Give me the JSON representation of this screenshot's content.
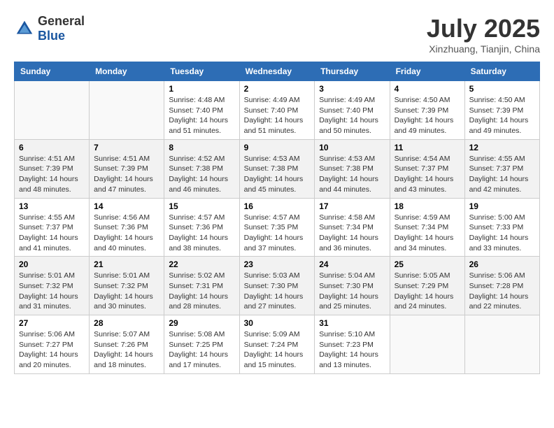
{
  "header": {
    "logo_general": "General",
    "logo_blue": "Blue",
    "month_title": "July 2025",
    "location": "Xinzhuang, Tianjin, China"
  },
  "days_of_week": [
    "Sunday",
    "Monday",
    "Tuesday",
    "Wednesday",
    "Thursday",
    "Friday",
    "Saturday"
  ],
  "weeks": [
    [
      {
        "day": "",
        "sunrise": "",
        "sunset": "",
        "daylight": ""
      },
      {
        "day": "",
        "sunrise": "",
        "sunset": "",
        "daylight": ""
      },
      {
        "day": "1",
        "sunrise": "Sunrise: 4:48 AM",
        "sunset": "Sunset: 7:40 PM",
        "daylight": "Daylight: 14 hours and 51 minutes."
      },
      {
        "day": "2",
        "sunrise": "Sunrise: 4:49 AM",
        "sunset": "Sunset: 7:40 PM",
        "daylight": "Daylight: 14 hours and 51 minutes."
      },
      {
        "day": "3",
        "sunrise": "Sunrise: 4:49 AM",
        "sunset": "Sunset: 7:40 PM",
        "daylight": "Daylight: 14 hours and 50 minutes."
      },
      {
        "day": "4",
        "sunrise": "Sunrise: 4:50 AM",
        "sunset": "Sunset: 7:39 PM",
        "daylight": "Daylight: 14 hours and 49 minutes."
      },
      {
        "day": "5",
        "sunrise": "Sunrise: 4:50 AM",
        "sunset": "Sunset: 7:39 PM",
        "daylight": "Daylight: 14 hours and 49 minutes."
      }
    ],
    [
      {
        "day": "6",
        "sunrise": "Sunrise: 4:51 AM",
        "sunset": "Sunset: 7:39 PM",
        "daylight": "Daylight: 14 hours and 48 minutes."
      },
      {
        "day": "7",
        "sunrise": "Sunrise: 4:51 AM",
        "sunset": "Sunset: 7:39 PM",
        "daylight": "Daylight: 14 hours and 47 minutes."
      },
      {
        "day": "8",
        "sunrise": "Sunrise: 4:52 AM",
        "sunset": "Sunset: 7:38 PM",
        "daylight": "Daylight: 14 hours and 46 minutes."
      },
      {
        "day": "9",
        "sunrise": "Sunrise: 4:53 AM",
        "sunset": "Sunset: 7:38 PM",
        "daylight": "Daylight: 14 hours and 45 minutes."
      },
      {
        "day": "10",
        "sunrise": "Sunrise: 4:53 AM",
        "sunset": "Sunset: 7:38 PM",
        "daylight": "Daylight: 14 hours and 44 minutes."
      },
      {
        "day": "11",
        "sunrise": "Sunrise: 4:54 AM",
        "sunset": "Sunset: 7:37 PM",
        "daylight": "Daylight: 14 hours and 43 minutes."
      },
      {
        "day": "12",
        "sunrise": "Sunrise: 4:55 AM",
        "sunset": "Sunset: 7:37 PM",
        "daylight": "Daylight: 14 hours and 42 minutes."
      }
    ],
    [
      {
        "day": "13",
        "sunrise": "Sunrise: 4:55 AM",
        "sunset": "Sunset: 7:37 PM",
        "daylight": "Daylight: 14 hours and 41 minutes."
      },
      {
        "day": "14",
        "sunrise": "Sunrise: 4:56 AM",
        "sunset": "Sunset: 7:36 PM",
        "daylight": "Daylight: 14 hours and 40 minutes."
      },
      {
        "day": "15",
        "sunrise": "Sunrise: 4:57 AM",
        "sunset": "Sunset: 7:36 PM",
        "daylight": "Daylight: 14 hours and 38 minutes."
      },
      {
        "day": "16",
        "sunrise": "Sunrise: 4:57 AM",
        "sunset": "Sunset: 7:35 PM",
        "daylight": "Daylight: 14 hours and 37 minutes."
      },
      {
        "day": "17",
        "sunrise": "Sunrise: 4:58 AM",
        "sunset": "Sunset: 7:34 PM",
        "daylight": "Daylight: 14 hours and 36 minutes."
      },
      {
        "day": "18",
        "sunrise": "Sunrise: 4:59 AM",
        "sunset": "Sunset: 7:34 PM",
        "daylight": "Daylight: 14 hours and 34 minutes."
      },
      {
        "day": "19",
        "sunrise": "Sunrise: 5:00 AM",
        "sunset": "Sunset: 7:33 PM",
        "daylight": "Daylight: 14 hours and 33 minutes."
      }
    ],
    [
      {
        "day": "20",
        "sunrise": "Sunrise: 5:01 AM",
        "sunset": "Sunset: 7:32 PM",
        "daylight": "Daylight: 14 hours and 31 minutes."
      },
      {
        "day": "21",
        "sunrise": "Sunrise: 5:01 AM",
        "sunset": "Sunset: 7:32 PM",
        "daylight": "Daylight: 14 hours and 30 minutes."
      },
      {
        "day": "22",
        "sunrise": "Sunrise: 5:02 AM",
        "sunset": "Sunset: 7:31 PM",
        "daylight": "Daylight: 14 hours and 28 minutes."
      },
      {
        "day": "23",
        "sunrise": "Sunrise: 5:03 AM",
        "sunset": "Sunset: 7:30 PM",
        "daylight": "Daylight: 14 hours and 27 minutes."
      },
      {
        "day": "24",
        "sunrise": "Sunrise: 5:04 AM",
        "sunset": "Sunset: 7:30 PM",
        "daylight": "Daylight: 14 hours and 25 minutes."
      },
      {
        "day": "25",
        "sunrise": "Sunrise: 5:05 AM",
        "sunset": "Sunset: 7:29 PM",
        "daylight": "Daylight: 14 hours and 24 minutes."
      },
      {
        "day": "26",
        "sunrise": "Sunrise: 5:06 AM",
        "sunset": "Sunset: 7:28 PM",
        "daylight": "Daylight: 14 hours and 22 minutes."
      }
    ],
    [
      {
        "day": "27",
        "sunrise": "Sunrise: 5:06 AM",
        "sunset": "Sunset: 7:27 PM",
        "daylight": "Daylight: 14 hours and 20 minutes."
      },
      {
        "day": "28",
        "sunrise": "Sunrise: 5:07 AM",
        "sunset": "Sunset: 7:26 PM",
        "daylight": "Daylight: 14 hours and 18 minutes."
      },
      {
        "day": "29",
        "sunrise": "Sunrise: 5:08 AM",
        "sunset": "Sunset: 7:25 PM",
        "daylight": "Daylight: 14 hours and 17 minutes."
      },
      {
        "day": "30",
        "sunrise": "Sunrise: 5:09 AM",
        "sunset": "Sunset: 7:24 PM",
        "daylight": "Daylight: 14 hours and 15 minutes."
      },
      {
        "day": "31",
        "sunrise": "Sunrise: 5:10 AM",
        "sunset": "Sunset: 7:23 PM",
        "daylight": "Daylight: 14 hours and 13 minutes."
      },
      {
        "day": "",
        "sunrise": "",
        "sunset": "",
        "daylight": ""
      },
      {
        "day": "",
        "sunrise": "",
        "sunset": "",
        "daylight": ""
      }
    ]
  ]
}
